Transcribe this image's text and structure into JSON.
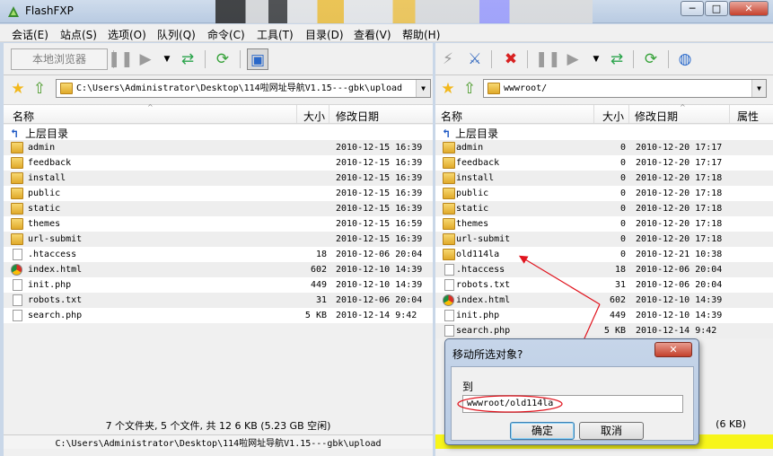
{
  "window": {
    "title": "FlashFXP",
    "min": "─",
    "max": "□",
    "close": "✕"
  },
  "menu": [
    "会话(E)",
    "站点(S)",
    "选项(O)",
    "队列(Q)",
    "命令(C)",
    "工具(T)",
    "目录(D)",
    "查看(V)",
    "帮助(H)"
  ],
  "left": {
    "local_browser": "本地浏览器",
    "path": "C:\\Users\\Administrator\\Desktop\\114啦网址导航V1.15---gbk\\upload",
    "columns": {
      "name": "名称",
      "size": "大小",
      "date": "修改日期"
    },
    "up_label": "上层目录",
    "rows": [
      {
        "name": "admin",
        "size": "",
        "date": "2010-12-15 16:39",
        "type": "folder"
      },
      {
        "name": "feedback",
        "size": "",
        "date": "2010-12-15 16:39",
        "type": "folder"
      },
      {
        "name": "install",
        "size": "",
        "date": "2010-12-15 16:39",
        "type": "folder"
      },
      {
        "name": "public",
        "size": "",
        "date": "2010-12-15 16:39",
        "type": "folder"
      },
      {
        "name": "static",
        "size": "",
        "date": "2010-12-15 16:39",
        "type": "folder"
      },
      {
        "name": "themes",
        "size": "",
        "date": "2010-12-15 16:59",
        "type": "folder"
      },
      {
        "name": "url-submit",
        "size": "",
        "date": "2010-12-15 16:39",
        "type": "folder"
      },
      {
        "name": ".htaccess",
        "size": "18",
        "date": "2010-12-06 20:04",
        "type": "file"
      },
      {
        "name": "index.html",
        "size": "602",
        "date": "2010-12-10 14:39",
        "type": "chrome"
      },
      {
        "name": "init.php",
        "size": "449",
        "date": "2010-12-10 14:39",
        "type": "file"
      },
      {
        "name": "robots.txt",
        "size": "31",
        "date": "2010-12-06 20:04",
        "type": "file"
      },
      {
        "name": "search.php",
        "size": "5 KB",
        "date": "2010-12-14 9:42",
        "type": "file"
      }
    ],
    "status1": "7 个文件夹, 5 个文件, 共 12 6 KB (5.23 GB 空闲)",
    "status2": "C:\\Users\\Administrator\\Desktop\\114啦网址导航V1.15---gbk\\upload"
  },
  "right": {
    "path": "wwwroot/",
    "columns": {
      "name": "名称",
      "size": "大小",
      "date": "修改日期",
      "attr": "属性"
    },
    "up_label": "上层目录",
    "rows": [
      {
        "name": "admin",
        "size": "0",
        "date": "2010-12-20 17:17",
        "type": "folder"
      },
      {
        "name": "feedback",
        "size": "0",
        "date": "2010-12-20 17:17",
        "type": "folder"
      },
      {
        "name": "install",
        "size": "0",
        "date": "2010-12-20 17:18",
        "type": "folder"
      },
      {
        "name": "public",
        "size": "0",
        "date": "2010-12-20 17:18",
        "type": "folder"
      },
      {
        "name": "static",
        "size": "0",
        "date": "2010-12-20 17:18",
        "type": "folder"
      },
      {
        "name": "themes",
        "size": "0",
        "date": "2010-12-20 17:18",
        "type": "folder"
      },
      {
        "name": "url-submit",
        "size": "0",
        "date": "2010-12-20 17:18",
        "type": "folder"
      },
      {
        "name": "old114la",
        "size": "0",
        "date": "2010-12-21 10:38",
        "type": "folder"
      },
      {
        "name": ".htaccess",
        "size": "18",
        "date": "2010-12-06 20:04",
        "type": "file"
      },
      {
        "name": "robots.txt",
        "size": "31",
        "date": "2010-12-06 20:04",
        "type": "file"
      },
      {
        "name": "index.html",
        "size": "602",
        "date": "2010-12-10 14:39",
        "type": "chrome"
      },
      {
        "name": "init.php",
        "size": "449",
        "date": "2010-12-10 14:39",
        "type": "file"
      },
      {
        "name": "search.php",
        "size": "5 KB",
        "date": "2010-12-14 9:42",
        "type": "file"
      }
    ],
    "status": "(6 KB)"
  },
  "dialog": {
    "title": "移动所选对象?",
    "close": "✕",
    "label": "到",
    "value": "wwwroot/old114la",
    "ok": "确定",
    "cancel": "取消"
  },
  "colors": {
    "title_bg": "#c9d7e8",
    "alt_row": "#eeeeee",
    "annotation": "#e0141e",
    "status_yellow": "#f7f51a"
  }
}
